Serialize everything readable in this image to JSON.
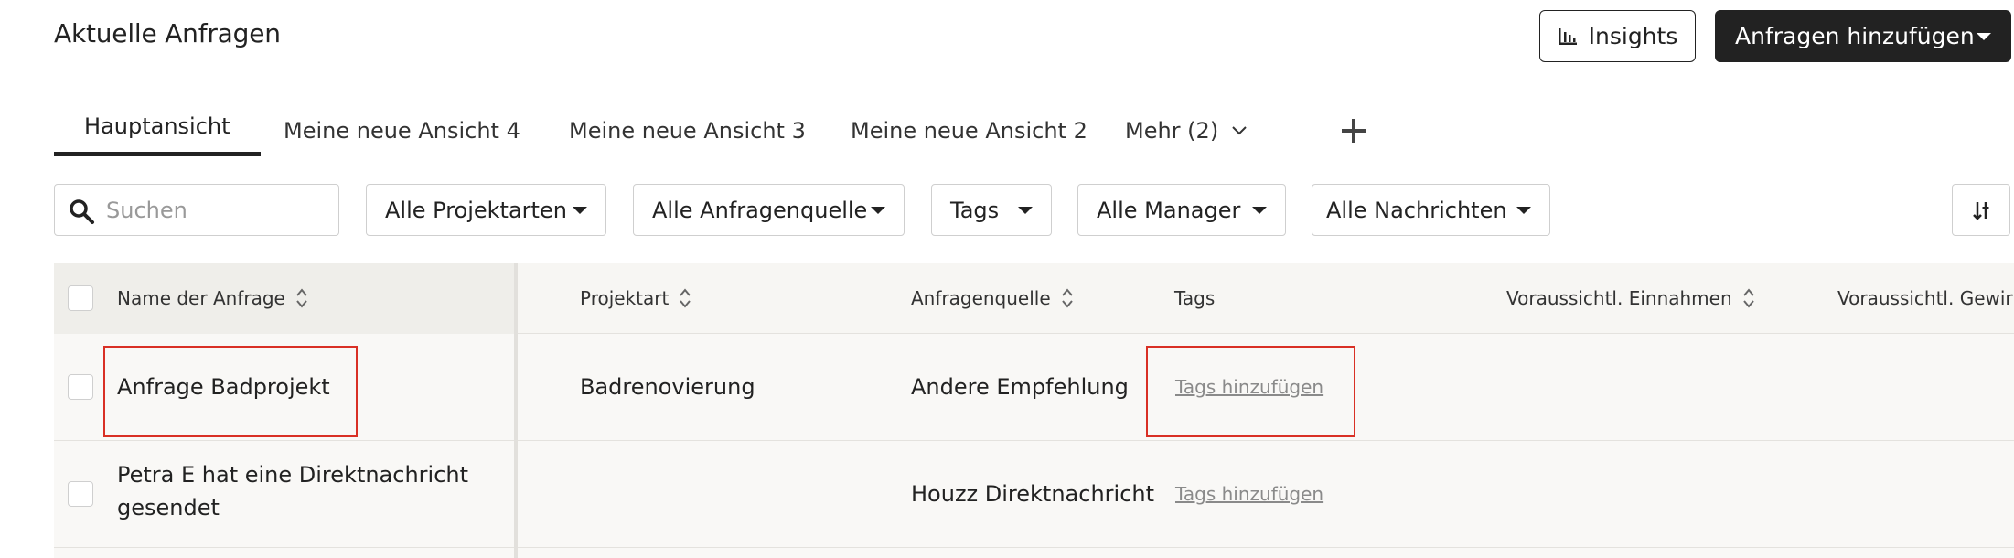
{
  "page": {
    "title": "Aktuelle Anfragen"
  },
  "header": {
    "insights_label": "Insights",
    "add_label": "Anfragen hinzufügen"
  },
  "tabs": [
    {
      "label": "Hauptansicht",
      "active": true
    },
    {
      "label": "Meine neue Ansicht 4",
      "active": false
    },
    {
      "label": "Meine neue Ansicht 3",
      "active": false
    },
    {
      "label": "Meine neue Ansicht 2",
      "active": false
    },
    {
      "label": "Mehr (2)",
      "active": false
    }
  ],
  "filters": {
    "search_placeholder": "Suchen",
    "project_types": "Alle Projektarten",
    "request_sources": "Alle Anfragenquelle",
    "tags": "Tags",
    "managers": "Alle Manager",
    "messages": "Alle Nachrichten"
  },
  "table": {
    "columns": [
      "Name der Anfrage",
      "Projektart",
      "Anfragenquelle",
      "Tags",
      "Voraussichtl. Einnahmen",
      "Voraussichtl. Gewir"
    ],
    "rows": [
      {
        "name": "Anfrage Badprojekt",
        "project_type": "Badrenovierung",
        "source": "Andere Empfehlung",
        "tags_link": "Tags hinzufügen"
      },
      {
        "name_line1": "Petra E hat eine Direktnachricht",
        "name_line2": "gesendet",
        "project_type": "",
        "source": "Houzz Direktnachricht",
        "tags_link": "Tags hinzufügen"
      }
    ]
  },
  "colors": {
    "primary_dark": "#222222",
    "highlight": "#d93025",
    "table_bg": "#f9f8f6",
    "link_gray": "#8a8a8a"
  },
  "icons": {
    "insights": "bar-chart-icon",
    "search": "search-icon",
    "more": "chevron-down-icon",
    "add_view": "plus-icon",
    "settings": "column-settings-icon",
    "sort": "sort-icon"
  }
}
